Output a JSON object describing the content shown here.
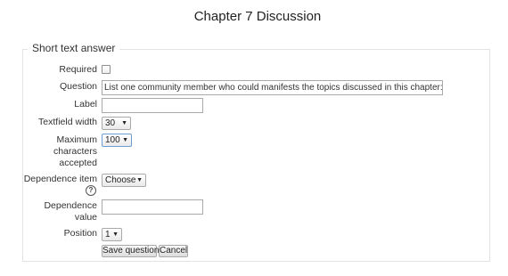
{
  "page": {
    "title": "Chapter 7 Discussion"
  },
  "form": {
    "legend": "Short text answer",
    "required": {
      "label": "Required",
      "checked": false
    },
    "question": {
      "label": "Question",
      "value": "List one community member who could manifests the topics discussed in this chapter:"
    },
    "label_field": {
      "label": "Label",
      "value": ""
    },
    "textfield_width": {
      "label": "Textfield width",
      "selected": "30"
    },
    "max_chars": {
      "label_lines": [
        "Maximum",
        "characters",
        "accepted"
      ],
      "selected": "100"
    },
    "dependence_item": {
      "label": "Dependence item",
      "selected": "Choose",
      "help_icon": "?"
    },
    "dependence_value": {
      "label_lines": [
        "Dependence",
        "value"
      ],
      "value": ""
    },
    "position": {
      "label": "Position",
      "selected": "1"
    },
    "buttons": {
      "save": "Save question",
      "cancel": "Cancel"
    }
  },
  "colors": {
    "focus_border": "#6a9fd4",
    "fieldset_border": "#e3e3e3"
  }
}
